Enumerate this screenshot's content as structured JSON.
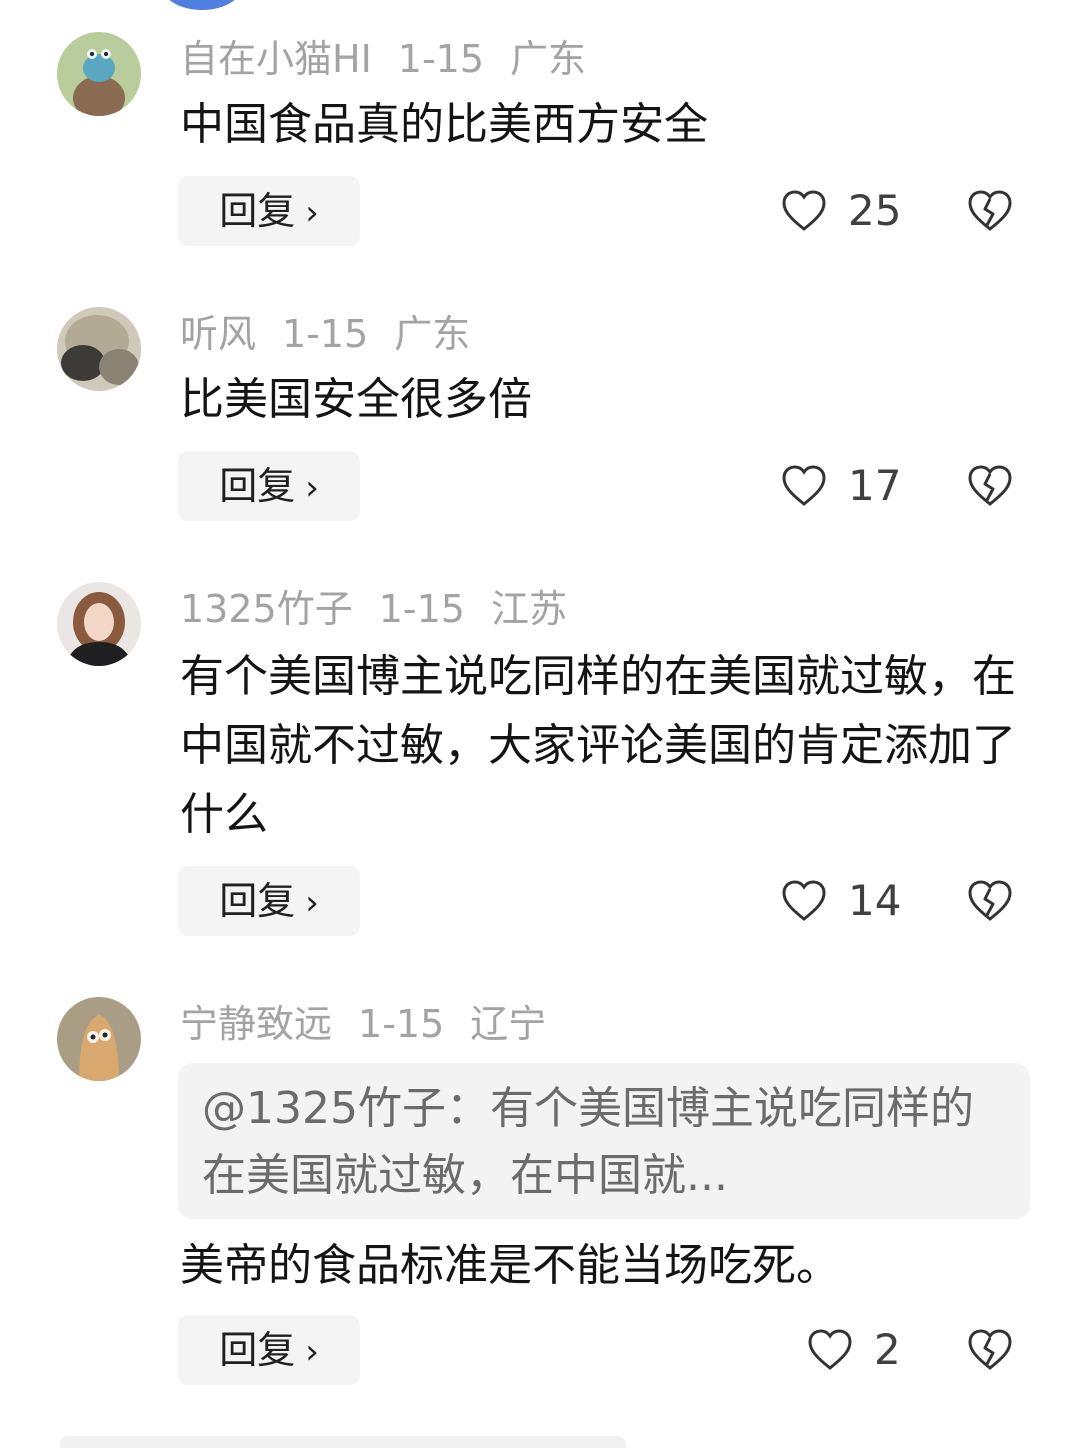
{
  "comments": [
    {
      "username": "自在小猫HI",
      "date": "1-15",
      "location": "广东",
      "text": "中国食品真的比美西方安全",
      "reply_label": "回复",
      "likes": "25"
    },
    {
      "username": "听风",
      "date": "1-15",
      "location": "广东",
      "text": "比美国安全很多倍",
      "reply_label": "回复",
      "likes": "17"
    },
    {
      "username": "1325竹子",
      "date": "1-15",
      "location": "江苏",
      "text": "有个美国博主说吃同样的在美国就过敏，在中国就不过敏，大家评论美国的肯定添加了什么",
      "reply_label": "回复",
      "likes": "14"
    },
    {
      "username": "宁静致远",
      "date": "1-15",
      "location": "辽宁",
      "quote": "@1325竹子：有个美国博主说吃同样的在美国就过敏，在中国就...",
      "text": "美帝的食品标准是不能当场吃死。",
      "reply_label": "回复",
      "likes": "2"
    }
  ],
  "colors": {
    "meta_text": "#a3a3a3",
    "body_text": "#141414",
    "reply_bg": "#f4f4f4",
    "quote_bg": "#f3f3f3",
    "icon_stroke": "#333333"
  },
  "icons": {
    "like": "heart-outline-icon",
    "dislike": "broken-heart-icon",
    "reply_chevron": "chevron-right-icon"
  }
}
